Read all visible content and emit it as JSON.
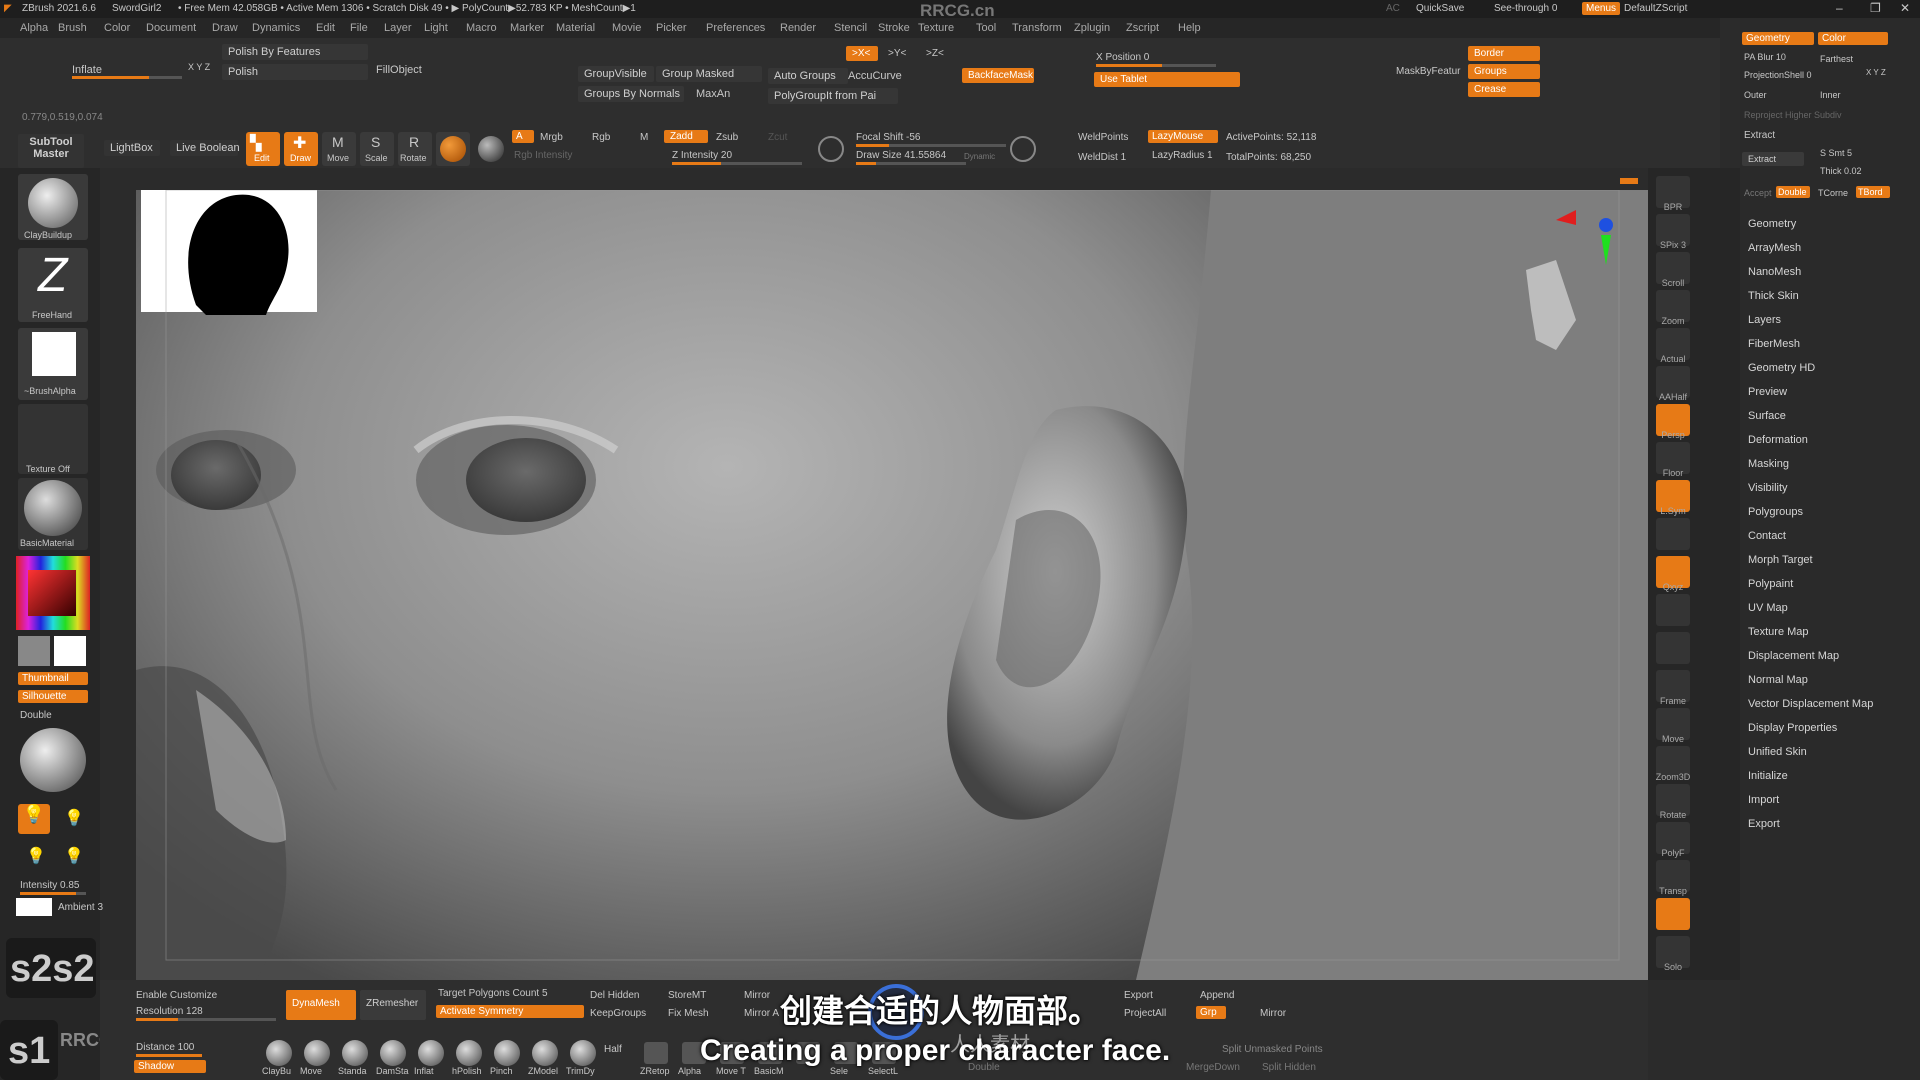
{
  "titlebar": {
    "app_title": "ZBrush 2021.6.6",
    "doc": "SwordGirl2",
    "mem": "• Free Mem 42.058GB • Active Mem 1306 • Scratch Disk 49 • ▶ PolyCount▶52.783 KP • MeshCount▶1",
    "watermark": "RRCG.cn",
    "ac": "AC",
    "quicksave": "QuickSave",
    "see_through": "See-through 0",
    "menus": "Menus",
    "script": "DefaultZScript"
  },
  "menubar": [
    "Alpha",
    "Brush",
    "Color",
    "Document",
    "Draw",
    "Dynamics",
    "Edit",
    "File",
    "Layer",
    "Light",
    "Macro",
    "Marker",
    "Material",
    "Movie",
    "Picker",
    "Preferences",
    "Render",
    "Stencil",
    "Stroke",
    "Texture",
    "Tool",
    "Transform",
    "Zplugin",
    "Zscript",
    "Help"
  ],
  "toolbar": {
    "polish_by_features": "Polish By Features",
    "polish": "Polish",
    "inflate": "Inflate",
    "xyz": "X Y Z",
    "fill_object": "FillObject",
    "coords": "0.779,0.519,0.074",
    "group_visible": "GroupVisible",
    "group_masked": "Group Masked",
    "groups_by_normals": "Groups By Normals",
    "maxan": "MaxAn",
    "auto_groups": "Auto Groups",
    "accucurve": "AccuCurve",
    "polygroupit": "PolyGroupIt from Pai",
    "sym_x": ">X<",
    "sym_y": ">Y<",
    "sym_z": ">Z<",
    "backface_mask": "BackfaceMask",
    "x_position": "X Position 0",
    "use_tablet": "Use Tablet",
    "mask_by_feature": "MaskByFeatur",
    "border": "Border",
    "groups": "Groups",
    "crease": "Crease",
    "subtool_master": "SubTool Master",
    "lightbox": "LightBox",
    "live_boolean": "Live Boolean",
    "edit": "Edit",
    "draw": "Draw",
    "move": "Move",
    "scale": "Scale",
    "rotate": "Rotate",
    "a": "A",
    "mrgb": "Mrgb",
    "rgb": "Rgb",
    "m": "M",
    "zadd": "Zadd",
    "zsub": "Zsub",
    "zcut": "Zcut",
    "rgb_intensity": "Rgb Intensity",
    "z_intensity": "Z Intensity 20",
    "focal_shift": "Focal Shift -56",
    "draw_size": "Draw Size 41.55864",
    "dynamic": "Dynamic",
    "weld_points": "WeldPoints",
    "weld_dist": "WeldDist 1",
    "lazy_mouse": "LazyMouse",
    "lazy_radius": "LazyRadius 1",
    "active_points": "ActivePoints: 52,118",
    "total_points": "TotalPoints: 68,250"
  },
  "leftshelf": {
    "brush1": "ClayBuildup",
    "brush2": "FreeHand",
    "brush3": "~BrushAlpha",
    "texture": "Texture Off",
    "material": "BasicMaterial",
    "thumbnail": "Thumbnail",
    "silhouette": "Silhouette",
    "double": "Double",
    "intensity": "Intensity 0.85",
    "ambient": "Ambient 3",
    "s2": "s2s2",
    "s1": "s1"
  },
  "rightshelf": [
    "BPR",
    "SPix 3",
    "Scroll",
    "Zoom",
    "Actual",
    "AAHalf",
    "Persp",
    "Floor",
    "L.Sym",
    "",
    "Qxyz",
    "",
    "",
    "Frame",
    "Move",
    "Zoom3D",
    "Rotate",
    "PolyF",
    "Transp",
    "",
    "Solo"
  ],
  "rightpanel": {
    "geometry": "Geometry",
    "color": "Color",
    "pa_blur": "PA Blur 10",
    "farthest": "Farthest",
    "projection_shell": "ProjectionShell 0",
    "xyz": "X Y Z",
    "outer": "Outer",
    "inner": "Inner",
    "reproject": "Reproject Higher Subdiv",
    "extract_header": "Extract",
    "extract": "Extract",
    "s_smt": "S Smt 5",
    "thick": "Thick 0.02",
    "accept": "Accept",
    "double": "Double",
    "tcorne": "TCorne",
    "tbord": "TBord",
    "items": [
      "Geometry",
      "ArrayMesh",
      "NanoMesh",
      "Thick Skin",
      "Layers",
      "FiberMesh",
      "Geometry HD",
      "Preview",
      "Surface",
      "Deformation",
      "Masking",
      "Visibility",
      "Polygroups",
      "Contact",
      "Morph Target",
      "Polypaint",
      "UV Map",
      "Texture Map",
      "Displacement Map",
      "Normal Map",
      "Vector Displacement Map",
      "Display Properties",
      "Unified Skin",
      "Initialize",
      "Import",
      "Export"
    ]
  },
  "bottom": {
    "enable_customize": "Enable Customize",
    "resolution": "Resolution 128",
    "dynamesh": "DynaMesh",
    "zremesher": "ZRemesher",
    "target_polygons": "Target Polygons Count 5",
    "activate_symmetry": "Activate Symmetry",
    "del_hidden": "Del Hidden",
    "keep_groups": "KeepGroups",
    "store_mt": "StoreMT",
    "fix_mesh": "Fix Mesh",
    "mirror": "Mirror",
    "mirror_and": "Mirror A",
    "export": "Export",
    "project_all": "ProjectAll",
    "append": "Append",
    "grp": "Grp",
    "mirror2": "Mirror",
    "split_unmasked": "Split Unmasked Points",
    "merge_down": "MergeDown",
    "split_hidden": "Split Hidden",
    "distance": "Distance 100",
    "shadow": "Shadow",
    "half": "Half",
    "double": "Double",
    "brushes": [
      "ClayBu",
      "Move",
      "Standa",
      "DamSta",
      "Inflat",
      "hPolish",
      "Pinch",
      "ZModel",
      "TrimDy"
    ],
    "bottom_icons": [
      "ZRetop",
      "Alpha",
      "Move T",
      "BasicM",
      "",
      "Sele",
      "SelectL"
    ]
  },
  "subtitles": {
    "chinese": "创建合适的人物面部。",
    "english": "Creating a proper character face."
  },
  "watermarks": {
    "logo": "RRCG",
    "cn": "人人素材"
  }
}
